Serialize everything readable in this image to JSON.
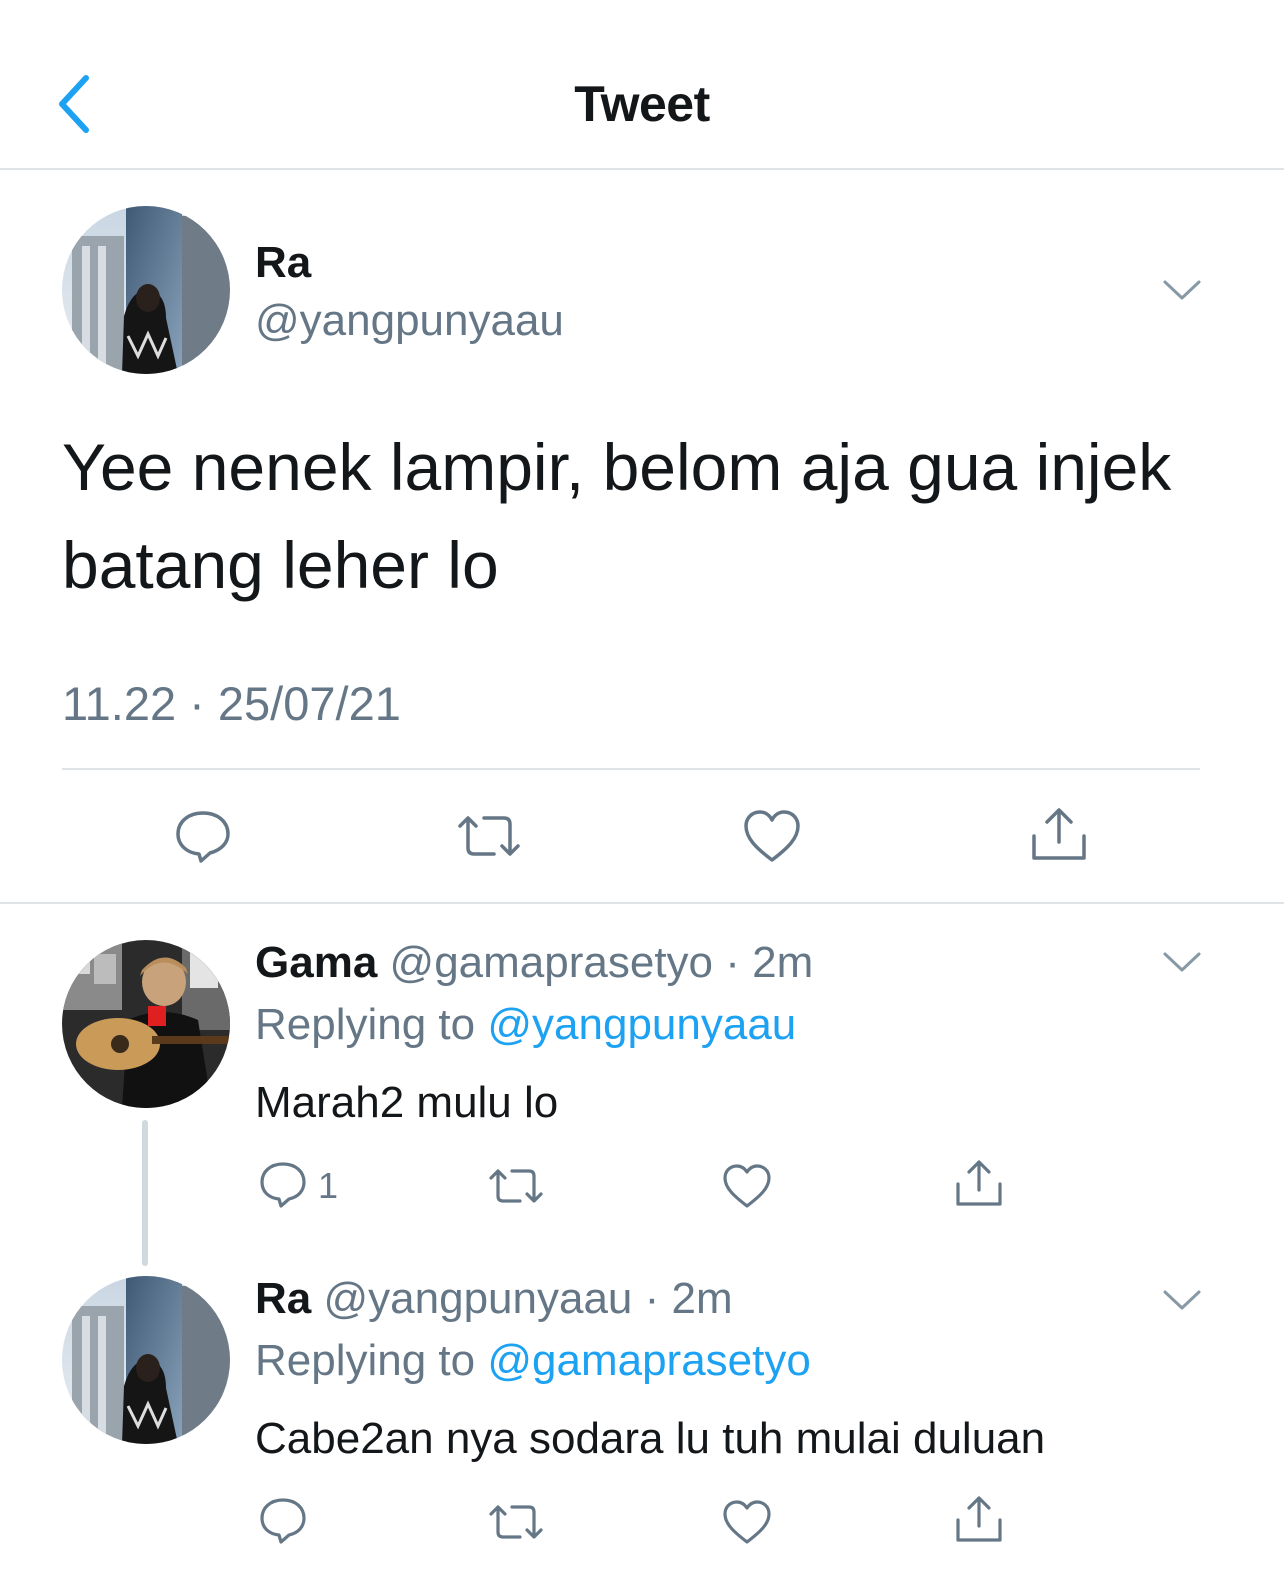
{
  "header": {
    "title": "Tweet",
    "back_icon": "chevron-left-icon"
  },
  "main_tweet": {
    "name": "Ra",
    "handle": "@yangpunyaau",
    "text_line1": "Yee nenek lampir, belom aja gua injek",
    "text_line2": "batang leher lo",
    "timestamp": "11.22 · 25/07/21",
    "actions": [
      "reply-icon",
      "retweet-icon",
      "like-icon",
      "share-icon"
    ]
  },
  "replies": [
    {
      "name": "Gama",
      "handle_time": "@gamaprasetyo · 2m",
      "replying_prefix": "Replying to ",
      "replying_to": "@yangpunyaau",
      "text": "Marah2 mulu lo",
      "reply_count": "1"
    },
    {
      "name": "Ra",
      "handle_time": "@yangpunyaau · 2m",
      "replying_prefix": "Replying to ",
      "replying_to": "@gamaprasetyo",
      "text": "Cabe2an nya sodara lu tuh mulai duluan",
      "reply_count": ""
    }
  ],
  "colors": {
    "accent": "#1da1f2",
    "secondary_text": "#657786",
    "divider": "#dfe3e6",
    "icon": "#657786"
  }
}
